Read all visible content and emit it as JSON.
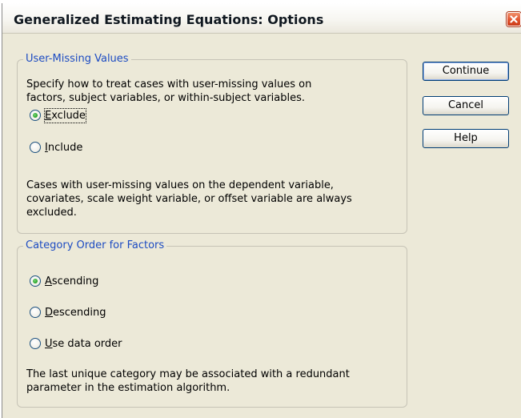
{
  "window": {
    "title": "Generalized Estimating Equations: Options"
  },
  "user_missing": {
    "legend": "User-Missing Values",
    "description_lines": [
      "Specify how to treat cases with user-missing values on",
      "factors, subject variables, or within-subject variables."
    ],
    "options": [
      {
        "label": "Exclude",
        "mnemonic": "E",
        "rest": "xclude",
        "selected": true
      },
      {
        "label": "Include",
        "mnemonic": "I",
        "rest": "nclude",
        "selected": false
      }
    ],
    "note_lines": [
      "Cases with user-missing values on the dependent variable,",
      "covariates, scale weight variable, or offset variable are always",
      "excluded."
    ]
  },
  "category_order": {
    "legend": "Category Order for Factors",
    "options": [
      {
        "label": "Ascending",
        "mnemonic": "A",
        "rest": "scending",
        "selected": true
      },
      {
        "label": "Descending",
        "mnemonic": "D",
        "rest": "escending",
        "selected": false
      },
      {
        "label": "Use data order",
        "mnemonic": "U",
        "rest": "se data order",
        "selected": false
      }
    ],
    "note_lines": [
      "The last unique category may be associated with a redundant",
      "parameter in the estimation algorithm."
    ]
  },
  "buttons": {
    "continue": "Continue",
    "cancel": "Cancel",
    "help": "Help"
  },
  "icons": {
    "close": "close-icon",
    "radio_selected_color": "#21a121",
    "accent": "#1c4bc2"
  }
}
